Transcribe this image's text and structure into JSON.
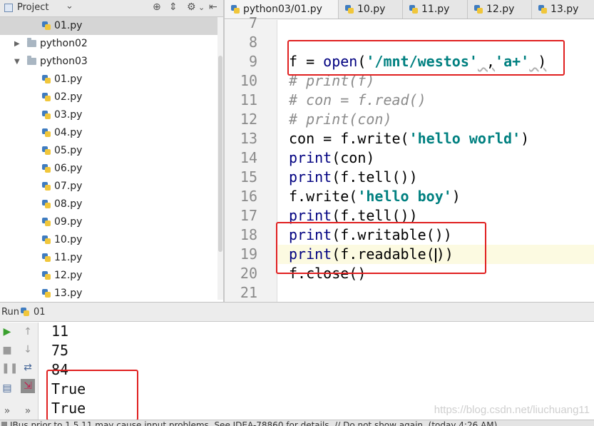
{
  "project_panel": {
    "title": "Project",
    "tree": [
      {
        "label": "01.py",
        "type": "file",
        "selected": true
      },
      {
        "label": "python02",
        "type": "folder",
        "expanded": false
      },
      {
        "label": "python03",
        "type": "folder",
        "expanded": true
      },
      {
        "label": "01.py",
        "type": "file"
      },
      {
        "label": "02.py",
        "type": "file"
      },
      {
        "label": "03.py",
        "type": "file"
      },
      {
        "label": "04.py",
        "type": "file"
      },
      {
        "label": "05.py",
        "type": "file"
      },
      {
        "label": "06.py",
        "type": "file"
      },
      {
        "label": "07.py",
        "type": "file"
      },
      {
        "label": "08.py",
        "type": "file"
      },
      {
        "label": "09.py",
        "type": "file"
      },
      {
        "label": "10.py",
        "type": "file"
      },
      {
        "label": "11.py",
        "type": "file"
      },
      {
        "label": "12.py",
        "type": "file"
      },
      {
        "label": "13.py",
        "type": "file"
      }
    ]
  },
  "tabs": [
    {
      "label": "python03/01.py",
      "active": true
    },
    {
      "label": "10.py"
    },
    {
      "label": "11.py"
    },
    {
      "label": "12.py"
    },
    {
      "label": "13.py"
    }
  ],
  "editor": {
    "current_line": "19",
    "lines": [
      {
        "num": "7"
      },
      {
        "num": "8"
      },
      {
        "num": "9"
      },
      {
        "num": "10"
      },
      {
        "num": "11"
      },
      {
        "num": "12"
      },
      {
        "num": "13"
      },
      {
        "num": "14"
      },
      {
        "num": "15"
      },
      {
        "num": "16"
      },
      {
        "num": "17"
      },
      {
        "num": "18"
      },
      {
        "num": "19"
      },
      {
        "num": "20"
      },
      {
        "num": "21"
      }
    ],
    "code": {
      "l9": {
        "a": "f = ",
        "b": "open",
        "c": "(",
        "d": "'/mnt/westos'",
        "e": " ,",
        "f": "'a+'",
        "g": " )"
      },
      "l10": "# print(f)",
      "l11": "# con = f.read()",
      "l12": "# print(con)",
      "l13": {
        "a": "con = f.write(",
        "b": "'hello world'",
        "c": ")"
      },
      "l14": {
        "a": "print",
        "b": "(con)"
      },
      "l15": {
        "a": "print",
        "b": "(f.tell())"
      },
      "l16": {
        "a": "f.write(",
        "b": "'hello boy'",
        "c": ")"
      },
      "l17": {
        "a": "print",
        "b": "(f.tell())"
      },
      "l18": {
        "a": "print",
        "b": "(f.writable())"
      },
      "l19": {
        "a": "print",
        "b": "(f.readable(",
        "c": "))"
      },
      "l20": "f.close()"
    }
  },
  "run_panel": {
    "label": "Run",
    "config": "01",
    "output": [
      "11",
      "75",
      "84",
      "True",
      "True"
    ],
    "watermark": "https://blog.csdn.net/liuchuang11"
  },
  "statusbar": {
    "message": "IBus prior to 1.5.11 may cause input problems. See IDEA-78860 for details. // Do not show again. (today 4:26 AM)"
  },
  "colors": {
    "highlight_box": "#e02020",
    "keyword": "#000080",
    "string": "#008080",
    "comment": "#8c8c8c",
    "current_line": "#fcfae1"
  }
}
